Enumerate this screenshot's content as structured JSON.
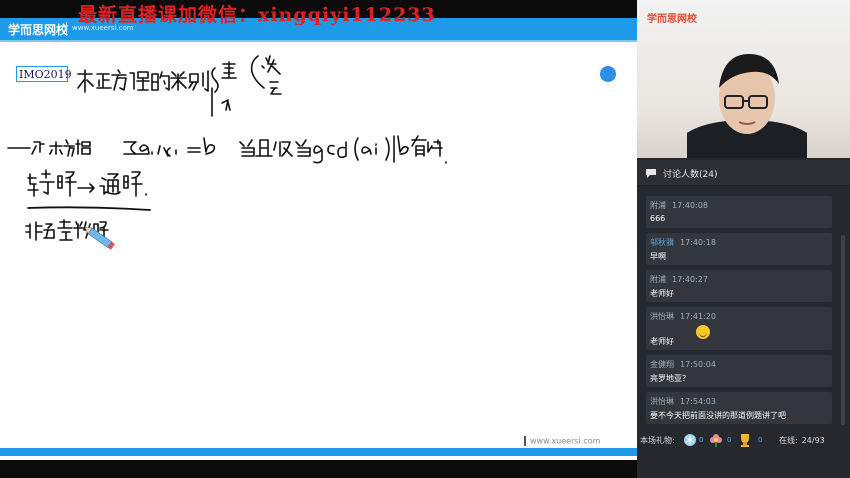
{
  "watermark": "最新直播课加微信：xingqiyi112233",
  "board": {
    "header_logo": "学而思网校",
    "header_site": "www.xueersi.com",
    "tag": "IMO2019",
    "footer_url": "www.xueersi.com"
  },
  "panel": {
    "camera_logo": "学而思网校",
    "discussion_label": "讨论人数(24)",
    "messages": [
      {
        "name": "附浦",
        "time": "17:40:08",
        "text": "666"
      },
      {
        "name": "邬秋骥",
        "time": "17:40:18",
        "text": "早啊"
      },
      {
        "name": "附浦",
        "time": "17:40:27",
        "text": "老师好"
      },
      {
        "name": "洪怡琳",
        "time": "17:41:20",
        "text": "老师好"
      },
      {
        "name": "金健翔",
        "time": "17:50:04",
        "text": "亮罗地亚？"
      },
      {
        "name": "洪怡琳",
        "time": "17:54:03",
        "text": "要不今天把前面没讲的那道例题讲了吧"
      }
    ],
    "gift_label": "本场礼物:",
    "gifts": [
      {
        "icon": "snowflake-icon",
        "count": "0"
      },
      {
        "icon": "flower-icon",
        "count": "0"
      },
      {
        "icon": "trophy-icon",
        "count": "0"
      }
    ],
    "online_label": "在线:",
    "online_count": "24/93"
  },
  "colors": {
    "brand_blue": "#1e9be8",
    "panel_bg": "#25282d",
    "watermark_red": "#e02020",
    "logo_orange": "#e8452f"
  }
}
